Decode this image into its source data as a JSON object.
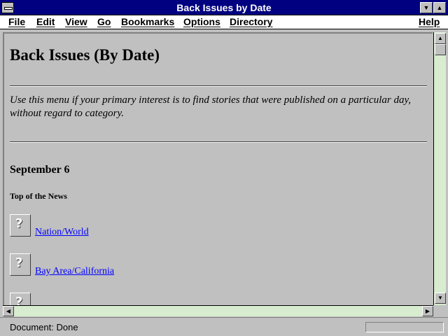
{
  "window": {
    "title": "Back Issues by Date"
  },
  "menu": [
    "File",
    "Edit",
    "View",
    "Go",
    "Bookmarks",
    "Options",
    "Directory",
    "Help"
  ],
  "page": {
    "title": "Back Issues (By Date)",
    "intro": "Use this menu if your primary interest is to find stories that were published on a particular day, without regard to category.",
    "date_heading": "September 6",
    "section_heading": "Top of the News",
    "links": [
      "Nation/World",
      "Bay Area/California"
    ]
  },
  "status": {
    "text": "Document: Done"
  },
  "icons": {
    "system_menu": "system-menu-icon",
    "minimize": "down-triangle-icon",
    "maximize": "up-triangle-icon",
    "broken_image": "broken-image-icon"
  }
}
